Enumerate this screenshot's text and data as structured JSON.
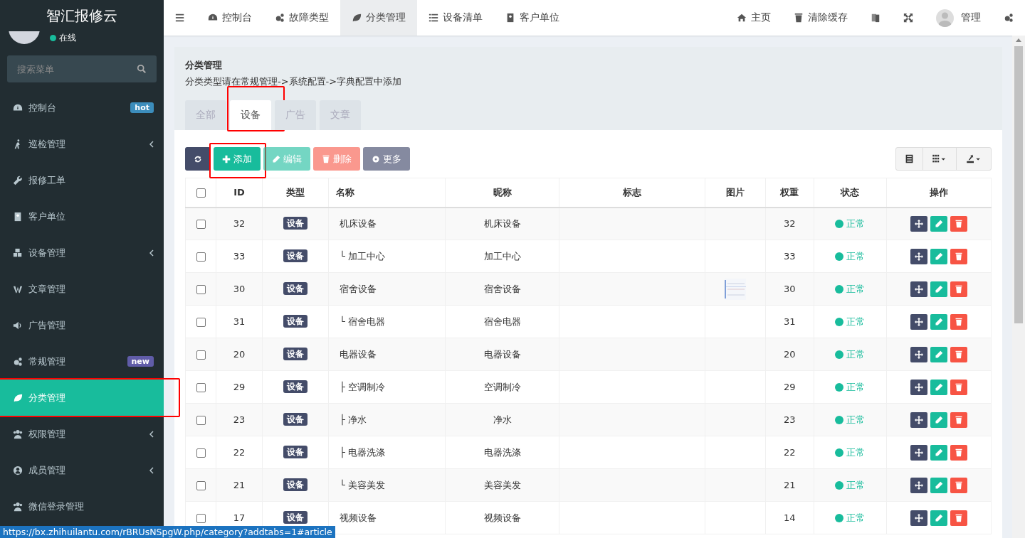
{
  "sidebar": {
    "logo": "智汇报修云",
    "user_status": "在线",
    "search": {
      "placeholder": "搜索菜单"
    },
    "items": [
      {
        "label": "控制台",
        "badge": "hot",
        "color": "#3c8dbc",
        "expandable": false,
        "selected": false,
        "highlighted": false
      },
      {
        "label": "巡检管理",
        "expandable": true,
        "selected": false,
        "highlighted": false
      },
      {
        "label": "报修工单",
        "expandable": false,
        "selected": false,
        "highlighted": false
      },
      {
        "label": "客户单位",
        "expandable": false,
        "selected": false,
        "highlighted": false
      },
      {
        "label": "设备管理",
        "expandable": true,
        "selected": false,
        "highlighted": false
      },
      {
        "label": "文章管理",
        "expandable": false,
        "selected": false,
        "highlighted": false
      },
      {
        "label": "广告管理",
        "expandable": false,
        "selected": false,
        "highlighted": false
      },
      {
        "label": "常规管理",
        "badge": "new",
        "color": "#605ca8",
        "expandable": false,
        "selected": false,
        "highlighted": false
      },
      {
        "label": "分类管理",
        "expandable": false,
        "selected": true,
        "highlighted": true
      },
      {
        "label": "权限管理",
        "expandable": true,
        "selected": false,
        "highlighted": false
      },
      {
        "label": "成员管理",
        "expandable": true,
        "selected": false,
        "highlighted": false
      },
      {
        "label": "微信登录管理",
        "expandable": false,
        "selected": false,
        "highlighted": false
      }
    ]
  },
  "top_nav": {
    "tabs": [
      {
        "label": "控制台",
        "selected": false
      },
      {
        "label": "故障类型",
        "selected": false
      },
      {
        "label": "分类管理",
        "selected": true
      },
      {
        "label": "设备清单",
        "selected": false
      },
      {
        "label": "客户单位",
        "selected": false
      }
    ],
    "home": "主页",
    "clear_cache": "清除缓存",
    "user": "管理"
  },
  "panel": {
    "title": "分类管理",
    "hint": "分类类型请在常规管理->系统配置->字典配置中添加",
    "tabs": [
      {
        "label": "全部",
        "selected": false,
        "highlighted": false
      },
      {
        "label": "设备",
        "selected": true,
        "highlighted": true
      },
      {
        "label": "广告",
        "selected": false,
        "highlighted": false
      },
      {
        "label": "文章",
        "selected": false,
        "highlighted": false
      }
    ],
    "toolbar": [
      {
        "kind": "refresh",
        "disabled": false,
        "highlighted": false
      },
      {
        "kind": "add",
        "label": "添加",
        "disabled": false,
        "highlighted": true
      },
      {
        "kind": "edit",
        "label": "编辑",
        "disabled": true,
        "highlighted": false
      },
      {
        "kind": "delete",
        "label": "删除",
        "disabled": true,
        "highlighted": false
      },
      {
        "kind": "more",
        "label": "更多",
        "disabled": false,
        "highlighted": false
      }
    ]
  },
  "table": {
    "all_checked": false,
    "columns": [
      "ID",
      "类型",
      "名称",
      "昵称",
      "标志",
      "图片",
      "权重",
      "状态",
      "操作"
    ],
    "rows": [
      {
        "checked": false,
        "id": "32",
        "type": "设备",
        "name": "机床设备",
        "nickname": "机床设备",
        "weight": "32",
        "status": "正常",
        "image": false
      },
      {
        "checked": false,
        "id": "33",
        "type": "设备",
        "name": "└ 加工中心",
        "nickname": "加工中心",
        "weight": "33",
        "status": "正常",
        "image": false
      },
      {
        "checked": false,
        "id": "30",
        "type": "设备",
        "name": "宿舍设备",
        "nickname": "宿舍设备",
        "weight": "30",
        "status": "正常",
        "image": true
      },
      {
        "checked": false,
        "id": "31",
        "type": "设备",
        "name": "└ 宿舍电器",
        "nickname": "宿舍电器",
        "weight": "31",
        "status": "正常",
        "image": false
      },
      {
        "checked": false,
        "id": "20",
        "type": "设备",
        "name": "电器设备",
        "nickname": "电器设备",
        "weight": "20",
        "status": "正常",
        "image": false
      },
      {
        "checked": false,
        "id": "29",
        "type": "设备",
        "name": "├ 空调制冷",
        "nickname": "空调制冷",
        "weight": "29",
        "status": "正常",
        "image": false
      },
      {
        "checked": false,
        "id": "23",
        "type": "设备",
        "name": "├ 净水",
        "nickname": "净水",
        "weight": "23",
        "status": "正常",
        "image": false
      },
      {
        "checked": false,
        "id": "22",
        "type": "设备",
        "name": "├ 电器洗涤",
        "nickname": "电器洗涤",
        "weight": "22",
        "status": "正常",
        "image": false
      },
      {
        "checked": false,
        "id": "21",
        "type": "设备",
        "name": "└ 美容美发",
        "nickname": "美容美发",
        "weight": "21",
        "status": "正常",
        "image": false
      },
      {
        "checked": false,
        "id": "17",
        "type": "设备",
        "name": "视频设备",
        "nickname": "视频设备",
        "weight": "14",
        "status": "正常",
        "image": false
      }
    ]
  },
  "status_link": "https://bx.zhihuilantu.com/rBRUsNSpgW.php/category?addtabs=1#article"
}
